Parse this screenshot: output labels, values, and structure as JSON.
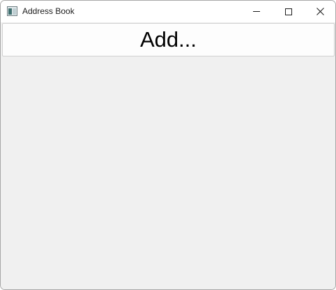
{
  "window": {
    "title": "Address Book",
    "app_icon": "address-book-app-icon",
    "controls": {
      "minimize_icon": "minimize-icon",
      "maximize_icon": "maximize-icon",
      "close_icon": "close-icon"
    }
  },
  "main": {
    "add_button_label": "Add..."
  },
  "colors": {
    "titlebar_background": "#ffffff",
    "client_background": "#f0f0f0",
    "button_background": "#fdfdfd",
    "button_border": "#d0d0d0",
    "text": "#000000"
  }
}
